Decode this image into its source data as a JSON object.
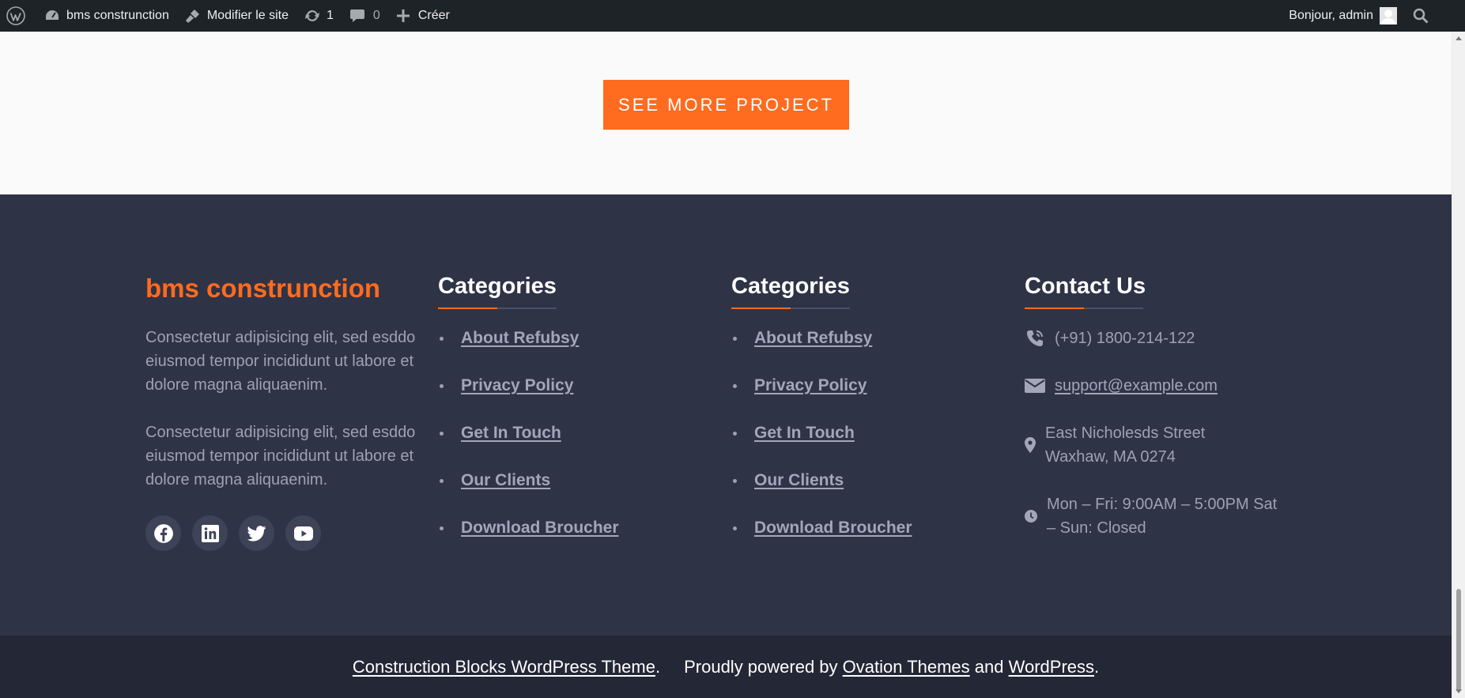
{
  "admin_bar": {
    "site_name": "bms construnction",
    "edit_site": "Modifier le site",
    "updates_count": "1",
    "comments_count": "0",
    "new_label": "Créer",
    "greeting": "Bonjour, admin"
  },
  "main": {
    "see_more_label": "SEE MORE PROJECT"
  },
  "footer": {
    "brand": "bms construnction",
    "about_paragraphs": [
      "Consectetur adipisicing elit, sed esddo eiusmod tempor incididunt ut labore et dolore magna aliquaenim.",
      "Consectetur adipisicing elit, sed esddo eiusmod tempor incididunt ut labore et dolore magna aliquaenim."
    ],
    "socials": [
      "facebook",
      "linkedin",
      "twitter",
      "youtube"
    ],
    "columns": [
      {
        "title": "Categories",
        "links": [
          "About Refubsy",
          "Privacy Policy",
          "Get In Touch",
          "Our Clients",
          "Download Broucher"
        ]
      },
      {
        "title": "Categories",
        "links": [
          "About Refubsy",
          "Privacy Policy",
          "Get In Touch",
          "Our Clients",
          "Download Broucher"
        ]
      }
    ],
    "contact": {
      "title": "Contact Us",
      "phone": "(+91) 1800-214-122",
      "email": "support@example.com",
      "address": "East Nicholesds Street Waxhaw, MA 0274",
      "hours": "Mon – Fri: 9:00AM – 5:00PM Sat – Sun: Closed"
    },
    "bottom": {
      "theme_link": "Construction Blocks WordPress Theme",
      "period1": ".",
      "powered_by": "Proudly powered by ",
      "ovation_link": "Ovation Themes",
      "and_text": " and ",
      "wordpress_link": "WordPress",
      "period2": "."
    }
  },
  "colors": {
    "accent": "#ff6b1f",
    "footer_bg": "#2f3346",
    "bottom_bg": "#242736",
    "admin_bar_bg": "#1d2327"
  }
}
